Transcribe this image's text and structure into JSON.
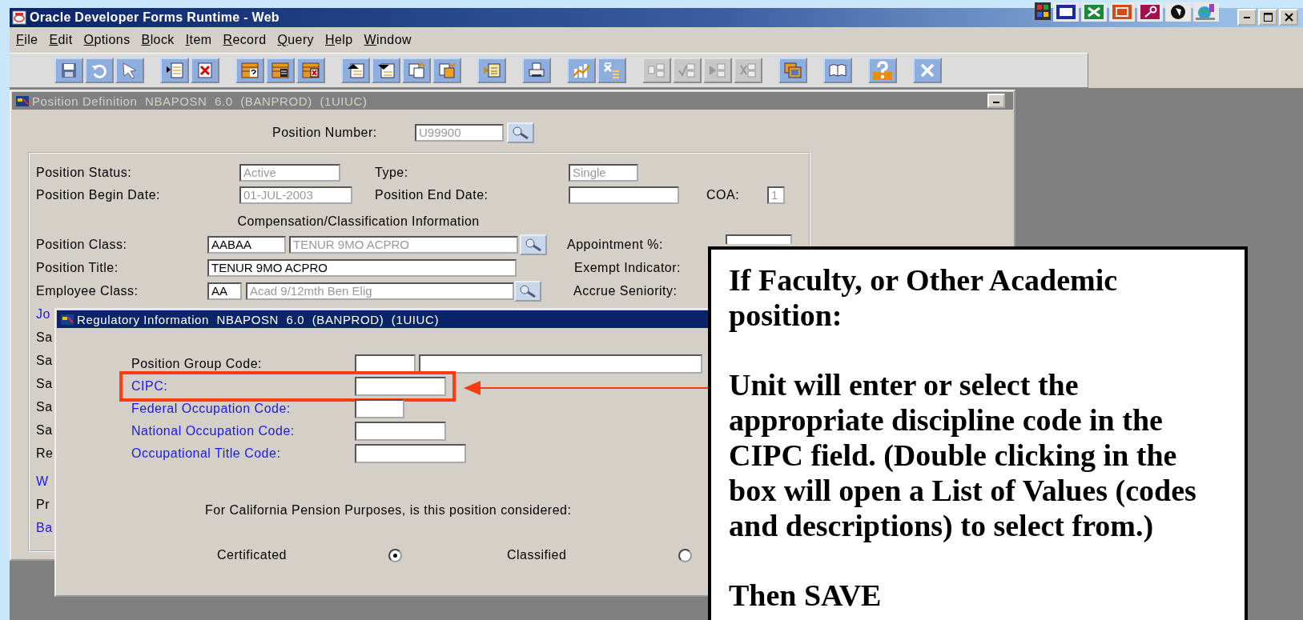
{
  "window": {
    "title": "Oracle Developer Forms Runtime - Web"
  },
  "menu": [
    {
      "label": "File"
    },
    {
      "label": "Edit"
    },
    {
      "label": "Options"
    },
    {
      "label": "Block"
    },
    {
      "label": "Item"
    },
    {
      "label": "Record"
    },
    {
      "label": "Query"
    },
    {
      "label": "Help"
    },
    {
      "label": "Window"
    }
  ],
  "toolbar": [
    {
      "buttons": [
        {
          "kind": "save",
          "disabled": false
        },
        {
          "kind": "rollback",
          "disabled": false
        },
        {
          "kind": "select",
          "disabled": false
        }
      ]
    },
    {
      "buttons": [
        {
          "kind": "insert",
          "disabled": false
        },
        {
          "kind": "remove",
          "disabled": false
        }
      ]
    },
    {
      "buttons": [
        {
          "kind": "enter_query",
          "disabled": false
        },
        {
          "kind": "execute_query",
          "disabled": false
        },
        {
          "kind": "cancel_query",
          "disabled": false
        }
      ]
    },
    {
      "buttons": [
        {
          "kind": "prev_block",
          "disabled": false
        },
        {
          "kind": "next_block",
          "disabled": false
        },
        {
          "kind": "prev_record",
          "disabled": false
        },
        {
          "kind": "next_record",
          "disabled": false
        }
      ]
    },
    {
      "buttons": [
        {
          "kind": "list",
          "disabled": false
        }
      ]
    },
    {
      "buttons": [
        {
          "kind": "print",
          "disabled": false
        }
      ]
    },
    {
      "buttons": [
        {
          "kind": "chart",
          "disabled": false
        },
        {
          "kind": "stats",
          "disabled": false
        }
      ]
    },
    {
      "buttons": [
        {
          "kind": "nav_a",
          "disabled": true
        },
        {
          "kind": "nav_b",
          "disabled": true
        },
        {
          "kind": "nav_c",
          "disabled": true
        },
        {
          "kind": "nav_d",
          "disabled": true
        }
      ]
    },
    {
      "buttons": [
        {
          "kind": "key_help",
          "disabled": false
        }
      ]
    },
    {
      "buttons": [
        {
          "kind": "book",
          "disabled": false
        }
      ]
    },
    {
      "buttons": [
        {
          "kind": "help",
          "disabled": false
        }
      ]
    },
    {
      "buttons": [
        {
          "kind": "exit",
          "disabled": false
        }
      ]
    }
  ],
  "form_window": {
    "title": "Position Definition  NBAPOSN  6.0  (BANPROD)  (1UIUC)",
    "active": false,
    "position_number": {
      "label": "Position Number:",
      "value": "U99900",
      "disabled": true
    },
    "position_status": {
      "label": "Position Status:",
      "value": "Active",
      "disabled": true
    },
    "type": {
      "label": "Type:",
      "value": "Single",
      "disabled": true
    },
    "begin_date": {
      "label": "Position Begin Date:",
      "value": "01-JUL-2003",
      "disabled": true
    },
    "end_date": {
      "label": "Position End Date:"
    },
    "coa": {
      "label": "COA:",
      "value": "1",
      "disabled": true
    },
    "section_heading": "Compensation/Classification Information",
    "position_class": {
      "label": "Position Class:",
      "code": "AABAA",
      "description": "TENUR 9MO ACPRO",
      "disabled": true
    },
    "position_title": {
      "label": "Position Title:",
      "value": "TENUR 9MO ACPRO",
      "disabled": false
    },
    "employee_class": {
      "label": "Employee Class:",
      "code": "AA",
      "description": "Acad 9/12mth Ben Elig",
      "disabled": true
    },
    "appointment": {
      "label": "Appointment %:"
    },
    "exempt_indicator": {
      "label": "Exempt Indicator:"
    },
    "accrue_seniority": {
      "label": "Accrue Seniority:"
    },
    "covered_labels": [
      {
        "text": "Jo",
        "kind": "link"
      },
      {
        "text": "Sa",
        "kind": "plain"
      },
      {
        "text": "Sa",
        "kind": "plain"
      },
      {
        "text": "Sa",
        "kind": "plain"
      },
      {
        "text": "Sa",
        "kind": "plain"
      },
      {
        "text": "Sa",
        "kind": "plain"
      },
      {
        "text": "Re",
        "kind": "plain"
      },
      {
        "text": "W",
        "kind": "link"
      },
      {
        "text": "Pr",
        "kind": "plain"
      },
      {
        "text": "Ba",
        "kind": "link"
      }
    ]
  },
  "dialog": {
    "title": "Regulatory Information  NBAPOSN  6.0  (BANPROD)  (1UIUC)",
    "active": true,
    "fields": [
      {
        "label": "Position Group Code:",
        "link": false,
        "kind": "pair",
        "highlighted": false
      },
      {
        "label": "CIPC:",
        "link": true,
        "kind": "single",
        "highlighted": true
      },
      {
        "label": "Federal Occupation Code:",
        "link": true,
        "kind": "single",
        "highlighted": false
      },
      {
        "label": "National Occupation Code:",
        "link": true,
        "kind": "single",
        "highlighted": false
      },
      {
        "label": "Occupational Title Code:",
        "link": true,
        "kind": "single",
        "highlighted": false
      }
    ],
    "question": "For California Pension Purposes, is this position considered:",
    "options": [
      {
        "label": "Certificated",
        "selected": true
      },
      {
        "label": "Classified",
        "selected": false
      }
    ]
  },
  "callout": {
    "paragraphs": [
      "If Faculty, or Other Academic position:",
      "Unit will enter or select the appropriate discipline code in the CIPC field. (Double clicking in the box will open a List of Values (codes and descriptions) to select from.)",
      "Then SAVE"
    ]
  }
}
